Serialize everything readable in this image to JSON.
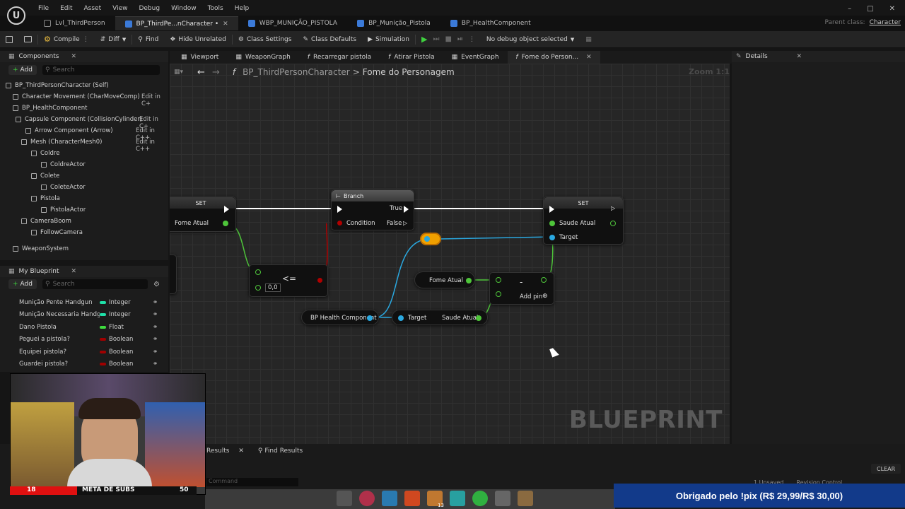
{
  "app": {
    "logo_text": "U",
    "menu": [
      "File",
      "Edit",
      "Asset",
      "View",
      "Debug",
      "Window",
      "Tools",
      "Help"
    ],
    "doc_tabs": [
      {
        "label": "Lvl_ThirdPerson",
        "active": false
      },
      {
        "label": "BP_ThirdPe...nCharacter •",
        "active": true
      },
      {
        "label": "WBP_MUNIÇÃO_PISTOLA",
        "active": false
      },
      {
        "label": "BP_Munição_Pistola",
        "active": false
      },
      {
        "label": "BP_HealthComponent",
        "active": false
      }
    ],
    "parent_class_label": "Parent class:",
    "parent_class_value": "Character"
  },
  "toolbar": {
    "compile": "Compile",
    "diff": "Diff",
    "find": "Find",
    "hide_unrelated": "Hide Unrelated",
    "class_settings": "Class Settings",
    "class_defaults": "Class Defaults",
    "simulation": "Simulation",
    "debug_object": "No debug object selected"
  },
  "components": {
    "title": "Components",
    "add": "Add",
    "search_placeholder": "Search",
    "items": [
      {
        "label": "BP_ThirdPersonCharacter (Self)",
        "edit": ""
      },
      {
        "label": "Character Movement (CharMoveComp)",
        "edit": "Edit in C+"
      },
      {
        "label": "BP_HealthComponent",
        "edit": ""
      },
      {
        "label": "Capsule Component (CollisionCylinder)",
        "edit": "Edit in C+"
      },
      {
        "label": "Arrow Component (Arrow)",
        "edit": "Edit in C++"
      },
      {
        "label": "Mesh (CharacterMesh0)",
        "edit": "Edit in C++"
      },
      {
        "label": "Coldre",
        "edit": ""
      },
      {
        "label": "ColdreActor",
        "edit": ""
      },
      {
        "label": "Colete",
        "edit": ""
      },
      {
        "label": "ColeteActor",
        "edit": ""
      },
      {
        "label": "Pistola",
        "edit": ""
      },
      {
        "label": "PistolaActor",
        "edit": ""
      },
      {
        "label": "CameraBoom",
        "edit": ""
      },
      {
        "label": "FollowCamera",
        "edit": ""
      },
      {
        "label": "WeaponSystem",
        "edit": ""
      }
    ]
  },
  "my_blueprint": {
    "title": "My Blueprint",
    "add": "Add",
    "search_placeholder": "Search",
    "variables": [
      {
        "name": "Munição Pente Handgun",
        "type": "Integer",
        "color": "#1fe0a8"
      },
      {
        "name": "Munição Necessaria Handgu",
        "type": "Integer",
        "color": "#1fe0a8"
      },
      {
        "name": "Dano Pistola",
        "type": "Float",
        "color": "#3edc3e"
      },
      {
        "name": "Peguei a pistola?",
        "type": "Boolean",
        "color": "#a00000"
      },
      {
        "name": "Equipei pistola?",
        "type": "Boolean",
        "color": "#a00000"
      },
      {
        "name": "Guardei pistola?",
        "type": "Boolean",
        "color": "#a00000"
      }
    ]
  },
  "graph_tabs": [
    {
      "label": "Viewport",
      "active": false
    },
    {
      "label": "WeaponGraph",
      "active": false
    },
    {
      "label": "Recarregar pistola",
      "active": false
    },
    {
      "label": "Atirar Pistola",
      "active": false
    },
    {
      "label": "EventGraph",
      "active": false
    },
    {
      "label": "Fome do Person...",
      "active": true
    }
  ],
  "breadcrumb": {
    "root": "BP_ThirdPersonCharacter",
    "sep": ">",
    "current": "Fome do Personagem"
  },
  "zoom": "Zoom 1:1",
  "nodes": {
    "set_left": {
      "title": "SET",
      "pin": "Fome Atual"
    },
    "compare": {
      "op": "<=",
      "value": "0,0"
    },
    "branch": {
      "title": "Branch",
      "condition": "Condition",
      "true": "True",
      "false": "False"
    },
    "set_right": {
      "title": "SET",
      "pin": "Saude Atual",
      "target": "Target"
    },
    "fome_atual": "Fome Atual",
    "subtract": {
      "op": "-",
      "add_pin": "Add pin"
    },
    "health_component": "BP Health Component",
    "get_saude": {
      "target": "Target",
      "value": "Saude Atual"
    }
  },
  "watermark": "BLUEPRINT",
  "details": {
    "title": "Details"
  },
  "bottom": {
    "tabs": [
      "Results",
      "Find Results"
    ],
    "clear": "CLEAR",
    "command_placeholder": "Command",
    "unsaved": "1 Unsaved",
    "revision": "Revision Control"
  },
  "stream": {
    "subs_current": "18",
    "subs_label": "META DE SUBS",
    "subs_goal": "50",
    "subs_progress": 0.36,
    "pix_message": "Obrigado pelo !pix (R$ 29,99/R$ 30,00)",
    "taskbar_badge": "13"
  }
}
